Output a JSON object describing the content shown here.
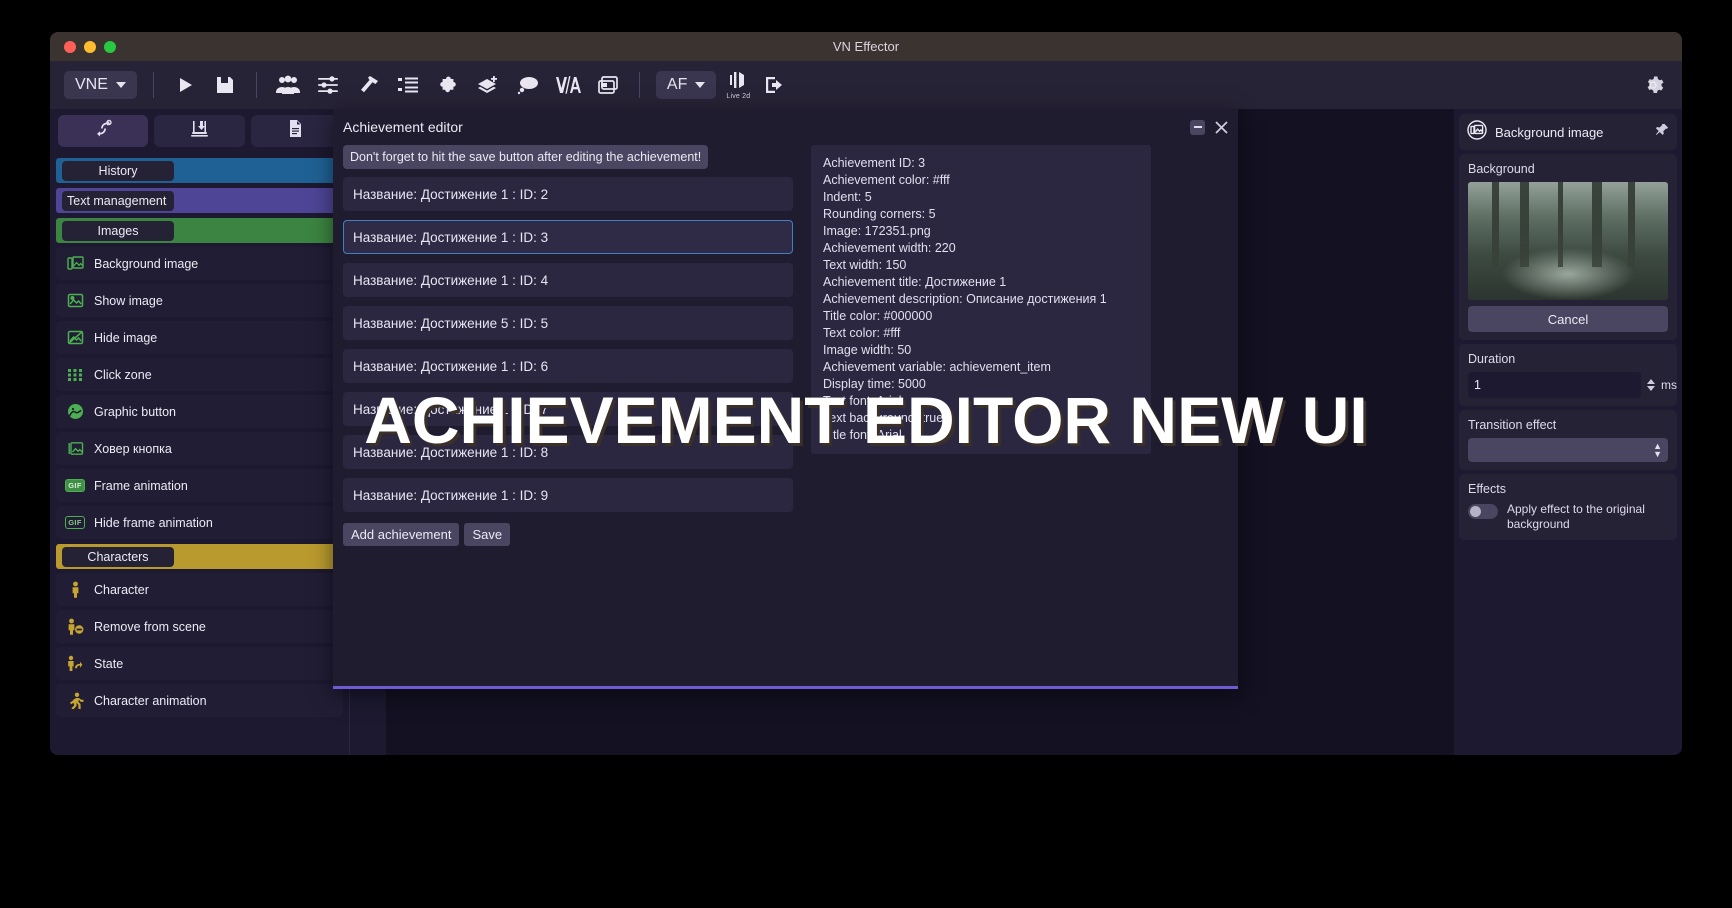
{
  "window": {
    "title": "VN Effector"
  },
  "toolbar": {
    "project_label": "VNE",
    "af_label": "AF",
    "live2d_label": "Live 2d",
    "icons": [
      "play-icon",
      "save-icon",
      "characters-icon",
      "sliders-icon",
      "hammer-icon",
      "list-tree-icon",
      "puzzle-icon",
      "layers-add-icon",
      "speech-bubble-icon",
      "voice-audio-icon",
      "windows-icon",
      "sound-wave-icon",
      "export-icon",
      "gear-icon"
    ]
  },
  "sidebar": {
    "tabs": [
      {
        "name": "transitions-tab",
        "icon": "shuffle-icon"
      },
      {
        "name": "import-tab",
        "icon": "import-icon"
      },
      {
        "name": "document-tab",
        "icon": "document-icon"
      }
    ],
    "categories": [
      {
        "label": "History",
        "color": "#1f6194"
      },
      {
        "label": "Text management",
        "color": "#4e4596"
      },
      {
        "label": "Images",
        "color": "#3c8442"
      },
      {
        "label": "Characters",
        "color": "#b99a2e"
      }
    ],
    "image_items": [
      {
        "label": "Background image",
        "icon": "background-image-icon"
      },
      {
        "label": "Show image",
        "icon": "show-image-icon"
      },
      {
        "label": "Hide image",
        "icon": "hide-image-icon"
      },
      {
        "label": "Click zone",
        "icon": "click-zone-icon"
      },
      {
        "label": "Graphic button",
        "icon": "graphic-button-icon"
      },
      {
        "label": "Ховер кнопка",
        "icon": "hover-button-icon"
      },
      {
        "label": "Frame animation",
        "icon": "gif-icon"
      },
      {
        "label": "Hide frame animation",
        "icon": "gif-outline-icon"
      }
    ],
    "character_items": [
      {
        "label": "Character",
        "icon": "person-icon"
      },
      {
        "label": "Remove from scene",
        "icon": "person-remove-icon"
      },
      {
        "label": "State",
        "icon": "person-state-icon"
      },
      {
        "label": "Character animation",
        "icon": "person-run-icon"
      }
    ]
  },
  "modal": {
    "title": "Achievement editor",
    "notice": "Don't forget to hit the save button after editing the achievement!",
    "achievements": [
      {
        "label": "Название: Достижение 1 :  ID: 2",
        "selected": false
      },
      {
        "label": "Название: Достижение 1 :  ID: 3",
        "selected": true
      },
      {
        "label": "Название: Достижение 1 :  ID: 4",
        "selected": false
      },
      {
        "label": "Название: Достижение 5 :  ID: 5",
        "selected": false
      },
      {
        "label": "Название: Достижение 1 :  ID: 6",
        "selected": false
      },
      {
        "label": "Название: Достижение 1 :  ID: 7",
        "selected": false
      },
      {
        "label": "Название: Достижение 1 :  ID: 8",
        "selected": false
      },
      {
        "label": "Название: Достижение 1 :  ID: 9",
        "selected": false
      }
    ],
    "add_label": "Add achievement",
    "save_label": "Save",
    "details": [
      "Achievement ID: 3",
      "Achievement color: #fff",
      "Indent: 5",
      "Rounding corners: 5",
      "Image: 172351.png",
      "Achievement width: 220",
      "Text width: 150",
      "Achievement title: Достижение 1",
      "Achievement description: Описание достижения 1",
      "Title color: #000000",
      "Text color: #fff",
      "Image width: 50",
      "Achievement variable: achievement_item",
      "Display time: 5000",
      "Text font: Arial",
      "Text background: true",
      "Title font: Arial"
    ],
    "header_icons": [
      "minimize-icon",
      "close-icon"
    ]
  },
  "stage": {
    "events": [
      {
        "has_check": false,
        "ok": false
      },
      {
        "has_check": false,
        "ok": false
      },
      {
        "has_check": false,
        "ok": false
      },
      {
        "has_check": true,
        "ok": true
      },
      {
        "has_check": false,
        "ok": false
      },
      {
        "has_check": false,
        "ok": false
      },
      {
        "has_check": true,
        "ok": false
      },
      {
        "has_check": false,
        "ok": false
      },
      {
        "has_check": false,
        "ok": false
      },
      {
        "has_check": true,
        "ok": false
      },
      {
        "has_check": false,
        "ok": false
      },
      {
        "has_check": false,
        "ok": false
      }
    ],
    "search_icon": "search-icon",
    "chevron_icon": "chevron-down-icon",
    "bug_icon": "bug-icon"
  },
  "rightpanel": {
    "header_title": "Background image",
    "header_icon": "background-image-icon",
    "pin_icon": "pin-icon",
    "background_label": "Background",
    "cancel_label": "Cancel",
    "duration_label": "Duration",
    "duration_value": "1",
    "duration_unit": "ms",
    "transition_label": "Transition effect",
    "transition_value": "",
    "effects_label": "Effects",
    "apply_effect_label": "Apply effect to the original background"
  },
  "watermark": {
    "text": "ACHIEVEMENT EDITOR NEW UI"
  },
  "colors": {
    "accent_purple": "#6c5bd4",
    "green": "#3f8f44",
    "blue": "#1f6194",
    "gold": "#b99a2e"
  }
}
